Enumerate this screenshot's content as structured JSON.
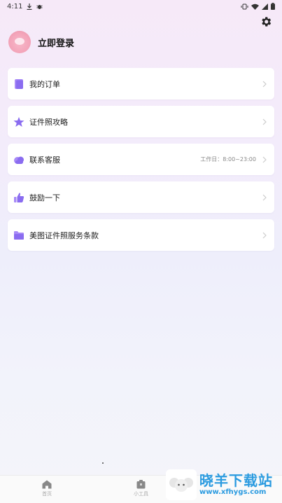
{
  "status_bar": {
    "time": "4:11",
    "icons": [
      "download-icon",
      "bug-icon",
      "vibrate-icon",
      "wifi-icon",
      "signal-icon",
      "battery-icon"
    ]
  },
  "header": {
    "settings_icon": "gear-icon"
  },
  "profile": {
    "login_label": "立即登录"
  },
  "menu": {
    "items": [
      {
        "label": "我的订单",
        "icon": "order-icon",
        "note": ""
      },
      {
        "label": "证件照攻略",
        "icon": "star-icon",
        "note": ""
      },
      {
        "label": "联系客服",
        "icon": "chat-cloud-icon",
        "note": "工作日：8:00~23:00"
      },
      {
        "label": "鼓励一下",
        "icon": "thumbs-up-icon",
        "note": ""
      },
      {
        "label": "美图证件照服务条款",
        "icon": "folder-icon",
        "note": ""
      }
    ]
  },
  "tabbar": {
    "tabs": [
      {
        "label": "首页",
        "icon": "home-icon"
      },
      {
        "label": "小工具",
        "icon": "toolbox-icon"
      }
    ]
  },
  "watermark": {
    "title": "晓羊下载站",
    "url": "www.xfhygs.com"
  },
  "colors": {
    "accent": "#8a6cf0",
    "icon_purple": "#9b7cf5",
    "watermark_blue": "#2b9be0"
  }
}
